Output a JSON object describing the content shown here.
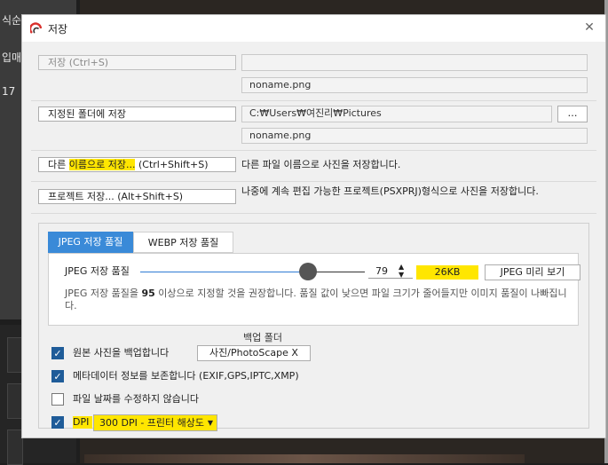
{
  "background": {
    "left_texts": [
      "식순",
      "입매",
      "17"
    ]
  },
  "dialog": {
    "title": "저장",
    "close_icon": "close-icon",
    "save_button": "저장   (Ctrl+S)",
    "save_path": "",
    "save_filename": "noname.png",
    "save_folder_button": "지정된 폴더에 저장",
    "folder_path": "C:₩Users₩여진리₩Pictures",
    "browse_button": "…",
    "folder_filename": "noname.png",
    "save_as_button": {
      "before": "다른 ",
      "highlight": "이름으로 저장...",
      "after": "   (Ctrl+Shift+S)"
    },
    "save_as_desc": "다른 파일 이름으로 사진을 저장합니다.",
    "project_button": "프로젝트 저장...   (Alt+Shift+S)",
    "project_desc": "나중에 계속 편집 가능한 프로젝트(PSXPRJ)형식으로 사진을 저장합니다.",
    "tabs": [
      "JPEG 저장 품질",
      "WEBP 저장 품질"
    ],
    "quality": {
      "label": "JPEG 저장 품질",
      "value": "79",
      "value_fraction": 0.79,
      "file_size": "26KB",
      "preview_button": "JPEG 미리 보기",
      "hint": "JPEG 저장 품질을 95 이상으로 지정할 것을 권장합니다. 품질 값이 낮으면 파일 크기가 줄어들지만 이미지 품질이 나빠집니다."
    },
    "backup_folder_label": "백업 폴더",
    "options": [
      {
        "label": "원본 사진을 백업합니다",
        "checked": true
      },
      {
        "label": "메타데이터 정보를 보존합니다 (EXIF,GPS,IPTC,XMP)",
        "checked": true
      },
      {
        "label": "파일 날짜를 수정하지 않습니다",
        "checked": false
      },
      {
        "label": "DPI",
        "checked": true
      }
    ],
    "backup_folder_button": "사진/PhotoScape X",
    "dpi_value": "300 DPI - 프린터 해상도",
    "colors": {
      "accent": "#3a8ad8",
      "highlight": "#ffe600",
      "checkbox": "#1f5c99"
    }
  }
}
